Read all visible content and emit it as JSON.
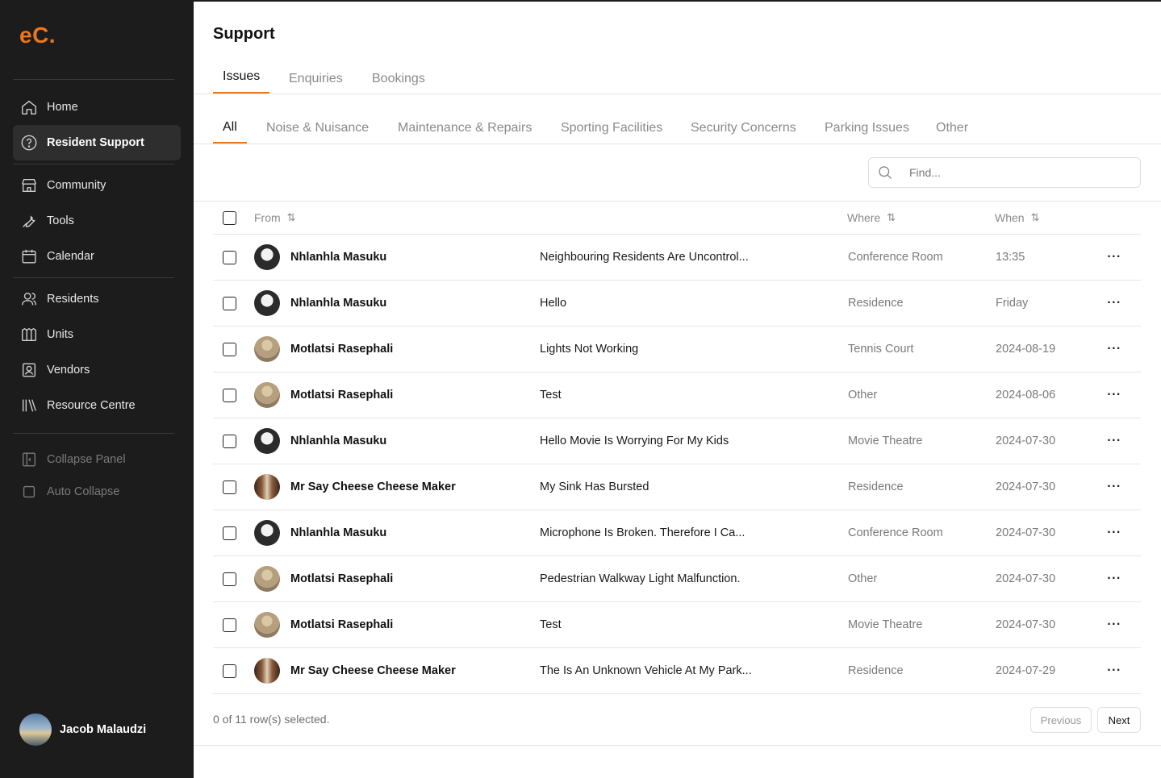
{
  "brand": {
    "logo": "eC.",
    "accent_color": "#e8771d"
  },
  "sidebar": {
    "items": [
      {
        "label": "Home",
        "icon": "home-icon"
      },
      {
        "label": "Resident Support",
        "icon": "help-circle-icon",
        "active": true
      },
      {
        "label": "Community",
        "icon": "store-icon"
      },
      {
        "label": "Tools",
        "icon": "wrench-icon"
      },
      {
        "label": "Calendar",
        "icon": "calendar-icon"
      },
      {
        "label": "Residents",
        "icon": "users-icon"
      },
      {
        "label": "Units",
        "icon": "building-icon"
      },
      {
        "label": "Vendors",
        "icon": "contact-icon"
      },
      {
        "label": "Resource Centre",
        "icon": "library-icon"
      }
    ],
    "collapse_panel": "Collapse Panel",
    "auto_collapse": "Auto Collapse",
    "user_name": "Jacob Malaudzi"
  },
  "page": {
    "title": "Support"
  },
  "tabs": [
    "Issues",
    "Enquiries",
    "Bookings"
  ],
  "active_tab": "Issues",
  "categories": [
    "All",
    "Noise & Nuisance",
    "Maintenance & Repairs",
    "Sporting Facilities",
    "Security Concerns",
    "Parking Issues",
    "Other"
  ],
  "active_category": "All",
  "search": {
    "placeholder": "Find..."
  },
  "table": {
    "headers": {
      "from": "From",
      "where": "Where",
      "when": "When"
    },
    "rows": [
      {
        "from": "Nhlanhla Masuku",
        "subject": "Neighbouring Residents Are Uncontrol...",
        "where": "Conference Room",
        "when": "13:35",
        "avatar": "a"
      },
      {
        "from": "Nhlanhla Masuku",
        "subject": "Hello",
        "where": "Residence",
        "when": "Friday",
        "avatar": "a"
      },
      {
        "from": "Motlatsi Rasephali",
        "subject": "Lights Not Working",
        "where": "Tennis Court",
        "when": "2024-08-19",
        "avatar": "b"
      },
      {
        "from": "Motlatsi Rasephali",
        "subject": "Test",
        "where": "Other",
        "when": "2024-08-06",
        "avatar": "b"
      },
      {
        "from": "Nhlanhla Masuku",
        "subject": "Hello Movie Is Worrying For My Kids",
        "where": "Movie Theatre",
        "when": "2024-07-30",
        "avatar": "a"
      },
      {
        "from": "Mr Say Cheese Cheese Maker",
        "subject": "My Sink Has Bursted",
        "where": "Residence",
        "when": "2024-07-30",
        "avatar": "c"
      },
      {
        "from": "Nhlanhla Masuku",
        "subject": "Microphone Is Broken. Therefore I Ca...",
        "where": "Conference Room",
        "when": "2024-07-30",
        "avatar": "a"
      },
      {
        "from": "Motlatsi Rasephali",
        "subject": "Pedestrian Walkway Light Malfunction.",
        "where": "Other",
        "when": "2024-07-30",
        "avatar": "b"
      },
      {
        "from": "Motlatsi Rasephali",
        "subject": "Test",
        "where": "Movie Theatre",
        "when": "2024-07-30",
        "avatar": "b"
      },
      {
        "from": "Mr Say Cheese Cheese Maker",
        "subject": "The Is An Unknown Vehicle At My Park...",
        "where": "Residence",
        "when": "2024-07-29",
        "avatar": "c"
      }
    ],
    "more_label": "···"
  },
  "footer": {
    "selection_text": "0 of 11 row(s) selected.",
    "previous": "Previous",
    "next": "Next"
  }
}
